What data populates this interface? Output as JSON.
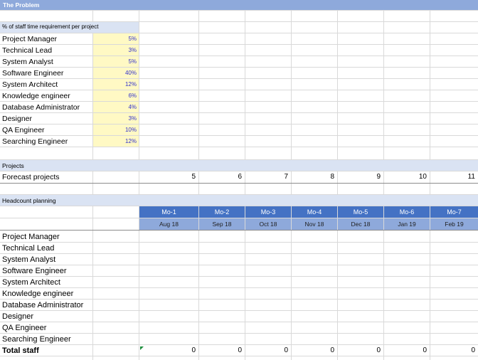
{
  "banner": {
    "title": "The Problem"
  },
  "staff_requirement": {
    "header": "% of staff time requirement per project",
    "roles": [
      {
        "name": "Project Manager",
        "pct": "5%"
      },
      {
        "name": "Technical Lead",
        "pct": "3%"
      },
      {
        "name": "System Analyst",
        "pct": "5%"
      },
      {
        "name": "Software Engineer",
        "pct": "40%"
      },
      {
        "name": "System Architect",
        "pct": "12%"
      },
      {
        "name": "Knowledge engineer",
        "pct": "6%"
      },
      {
        "name": "Database Administrator",
        "pct": "4%"
      },
      {
        "name": "Designer",
        "pct": "3%"
      },
      {
        "name": "QA Engineer",
        "pct": "10%"
      },
      {
        "name": "Searching Engineer",
        "pct": "12%"
      }
    ]
  },
  "projects": {
    "header": "Projects",
    "label": "Forecast projects",
    "values": [
      "5",
      "6",
      "7",
      "8",
      "9",
      "10",
      "11"
    ]
  },
  "headcount": {
    "header": "Headcount planning",
    "months": [
      "Mo-1",
      "Mo-2",
      "Mo-3",
      "Mo-4",
      "Mo-5",
      "Mo-6",
      "Mo-7"
    ],
    "dates": [
      "Aug 18",
      "Sep 18",
      "Oct 18",
      "Nov 18",
      "Dec 18",
      "Jan 19",
      "Feb 19"
    ],
    "roles": [
      "Project Manager",
      "Technical Lead",
      "System Analyst",
      "Software Engineer",
      "System Architect",
      "Knowledge engineer",
      "Database Administrator",
      "Designer",
      "QA Engineer",
      "Searching Engineer"
    ],
    "total_label": "Total staff",
    "totals": [
      "0",
      "0",
      "0",
      "0",
      "0",
      "0",
      "0"
    ]
  },
  "colors": {
    "banner": "#8ea9db",
    "section_band": "#dae3f3",
    "input_fill": "#fff9c4",
    "month_header": "#4472c4",
    "date_header": "#8ea9db"
  }
}
